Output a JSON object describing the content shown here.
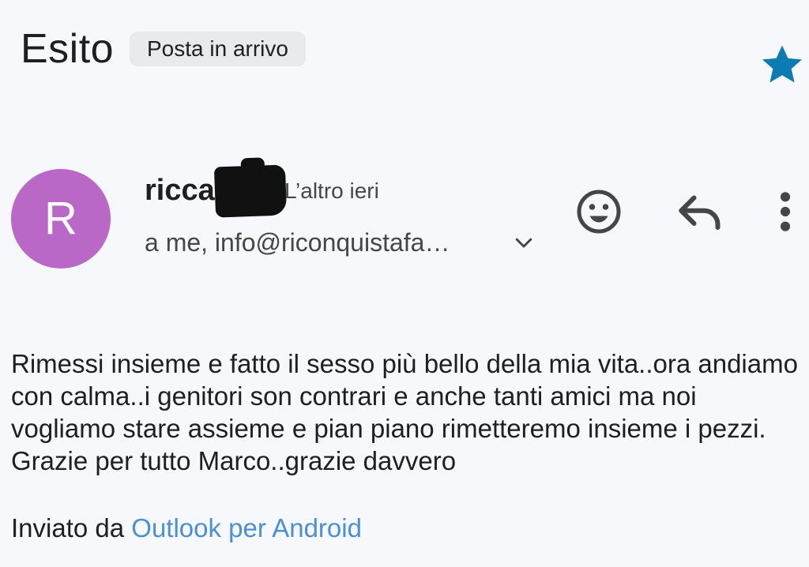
{
  "header": {
    "subject": "Esito",
    "label": "Posta in arrivo",
    "starred": true
  },
  "message": {
    "avatar_letter": "R",
    "avatar_color": "#ba68c8",
    "sender_visible": "ricca",
    "timestamp": "L’altro ieri",
    "recipients": "a me, info@riconquistafa…",
    "body": "Rimessi insieme e fatto il sesso più bello della mia vita..ora andiamo con calma..i genitori son contrari e anche tanti amici ma noi vogliamo stare assieme e pian piano rimetteremo insieme i pezzi. Grazie per tutto Marco..grazie davvero",
    "signature_prefix": "Inviato da ",
    "signature_link": "Outlook per Android"
  },
  "icons": {
    "star": "star-icon",
    "emoji": "emoji-react-icon",
    "reply": "reply-icon",
    "more": "more-vert-icon",
    "expand": "chevron-down-icon"
  },
  "colors": {
    "star": "#0b7cb1",
    "link": "#4a90d9",
    "background": "#f6f8fc",
    "chip": "#e8eaed"
  }
}
